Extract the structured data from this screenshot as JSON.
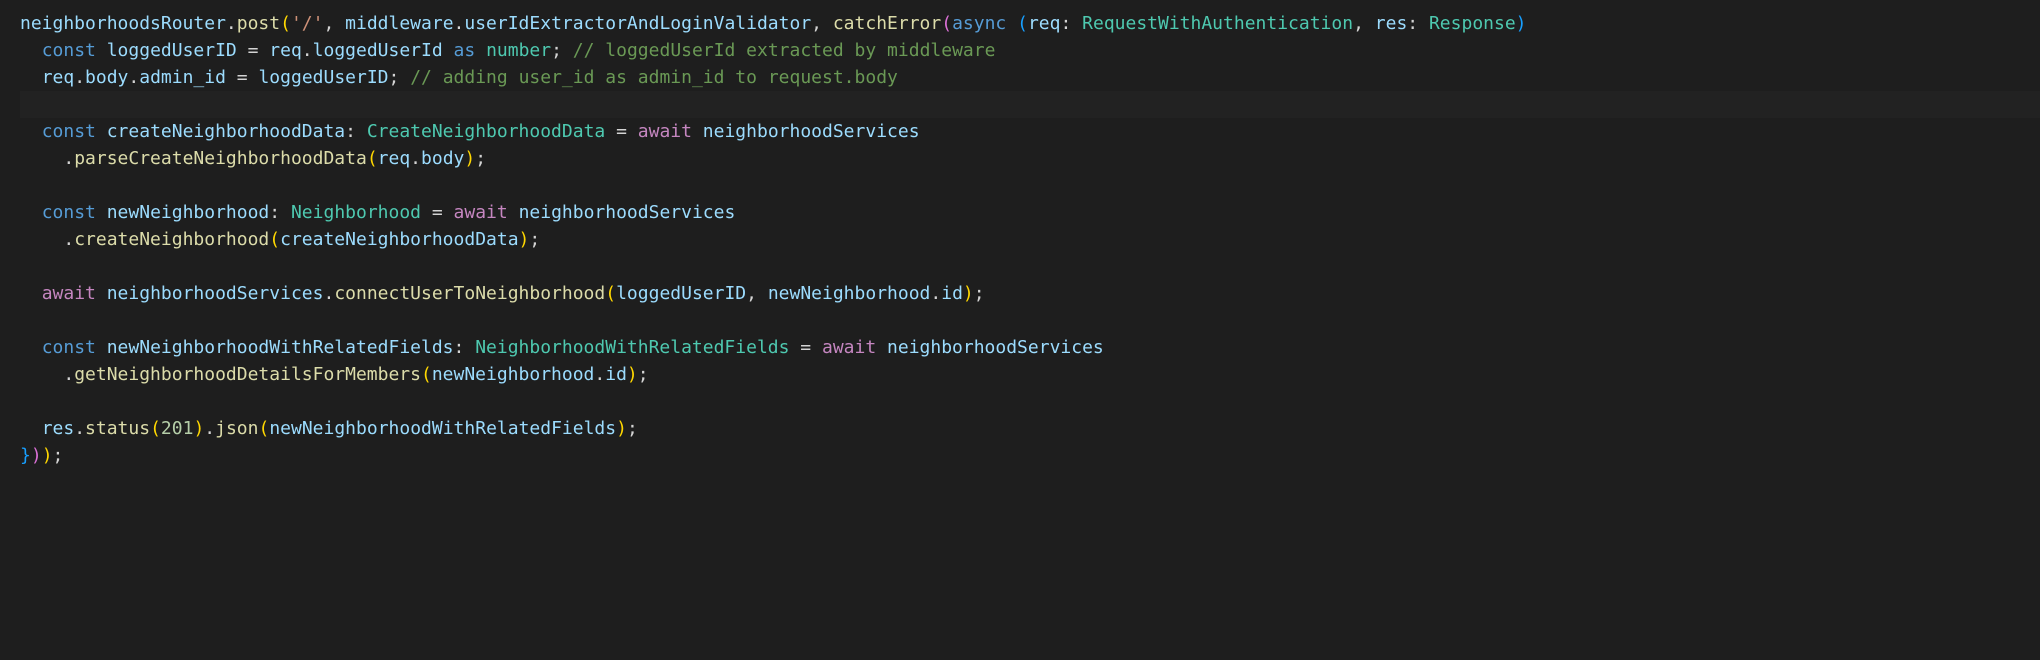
{
  "code": {
    "l1": {
      "obj": "neighborhoodsRouter",
      "method": "post",
      "route": "'/'",
      "mw_obj": "middleware",
      "mw_prop": "userIdExtractorAndLoginValidator",
      "catch": "catchError",
      "async": "async",
      "req": "req",
      "req_t": "RequestWithAuthentication",
      "res": "res",
      "res_t": "Response"
    },
    "l2": {
      "kw": "const",
      "var": "loggedUserID",
      "req": "req",
      "prop": "loggedUserId",
      "as": "as",
      "type": "number",
      "comment": "// loggedUserId extracted by middleware"
    },
    "l3": {
      "req": "req",
      "body": "body",
      "admin": "admin_id",
      "var": "loggedUserID",
      "comment": "// adding user_id as admin_id to request.body"
    },
    "l5": {
      "kw": "const",
      "var": "createNeighborhoodData",
      "type": "CreateNeighborhoodData",
      "await": "await",
      "svc": "neighborhoodServices"
    },
    "l6": {
      "fn": "parseCreateNeighborhoodData",
      "req": "req",
      "body": "body"
    },
    "l8": {
      "kw": "const",
      "var": "newNeighborhood",
      "type": "Neighborhood",
      "await": "await",
      "svc": "neighborhoodServices"
    },
    "l9": {
      "fn": "createNeighborhood",
      "arg": "createNeighborhoodData"
    },
    "l11": {
      "await": "await",
      "svc": "neighborhoodServices",
      "fn": "connectUserToNeighborhood",
      "arg1": "loggedUserID",
      "arg2": "newNeighborhood",
      "arg2p": "id"
    },
    "l13": {
      "kw": "const",
      "var": "newNeighborhoodWithRelatedFields",
      "type": "NeighborhoodWithRelatedFields",
      "await": "await",
      "svc": "neighborhoodServices"
    },
    "l14": {
      "fn": "getNeighborhoodDetailsForMembers",
      "arg": "newNeighborhood",
      "argp": "id"
    },
    "l16": {
      "res": "res",
      "status": "status",
      "code": "201",
      "json": "json",
      "arg": "newNeighborhoodWithRelatedFields"
    }
  }
}
